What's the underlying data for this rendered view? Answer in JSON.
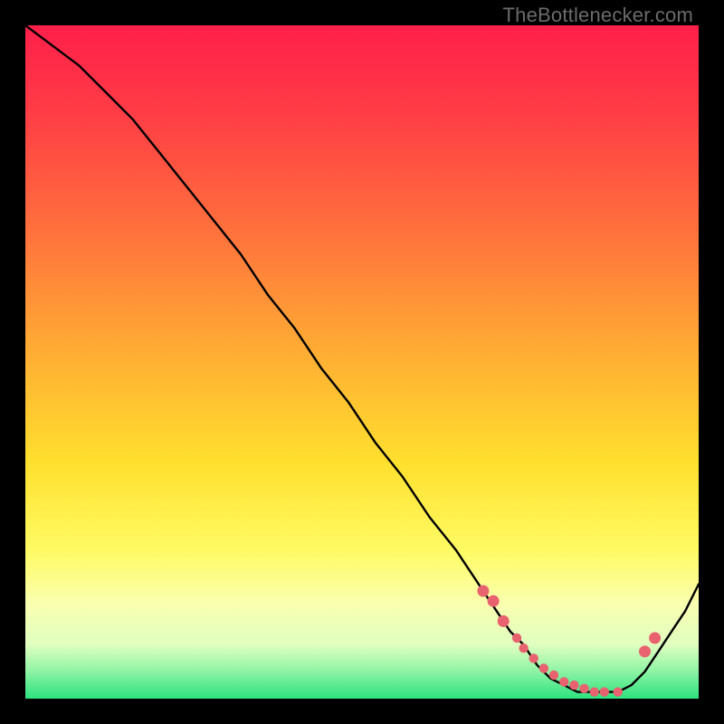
{
  "watermark": "TheBottlenecker.com",
  "chart_data": {
    "type": "line",
    "title": "",
    "xlabel": "",
    "ylabel": "",
    "xlim": [
      0,
      100
    ],
    "ylim": [
      0,
      100
    ],
    "series": [
      {
        "name": "curve",
        "x": [
          0,
          4,
          8,
          12,
          16,
          20,
          24,
          28,
          32,
          36,
          40,
          44,
          48,
          52,
          56,
          60,
          64,
          68,
          70,
          72,
          74,
          76,
          78,
          80,
          82,
          84,
          86,
          88,
          90,
          92,
          94,
          96,
          98,
          100
        ],
        "y": [
          100,
          97,
          94,
          90,
          86,
          81,
          76,
          71,
          66,
          60,
          55,
          49,
          44,
          38,
          33,
          27,
          22,
          16,
          13,
          10,
          8,
          5,
          3,
          2,
          1,
          1,
          1,
          1,
          2,
          4,
          7,
          10,
          13,
          17
        ]
      }
    ],
    "markers": {
      "name": "highlight-points",
      "x": [
        68,
        69.5,
        71,
        73,
        74,
        75.5,
        77,
        78.5,
        80,
        81.5,
        83,
        84.5,
        86,
        88,
        92,
        93.5
      ],
      "y": [
        16,
        14.5,
        11.5,
        9,
        7.5,
        6,
        4.5,
        3.5,
        2.5,
        2,
        1.5,
        1,
        1,
        1,
        7,
        9
      ]
    }
  }
}
